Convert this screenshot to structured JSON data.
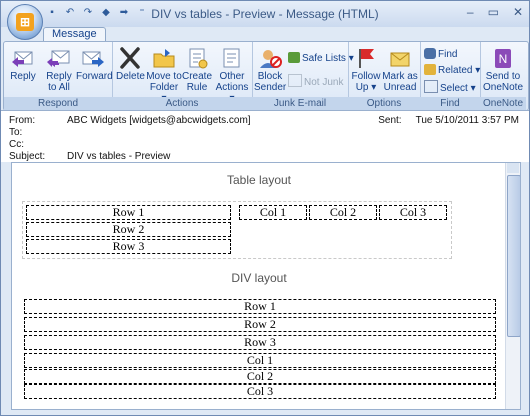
{
  "window": {
    "title": "DIV vs tables - Preview - Message (HTML)",
    "controls": {
      "minimize": "–",
      "maximize": "▭",
      "close": "✕"
    }
  },
  "ribbon": {
    "tab": "Message",
    "groups": {
      "respond": {
        "label": "Respond",
        "reply": "Reply",
        "reply_all_1": "Reply",
        "reply_all_2": "to All",
        "forward": "Forward"
      },
      "actions": {
        "label": "Actions",
        "delete": "Delete",
        "move_1": "Move to",
        "move_2": "Folder ▾",
        "rule_1": "Create",
        "rule_2": "Rule",
        "other_1": "Other",
        "other_2": "Actions ▾"
      },
      "junk": {
        "label": "Junk E-mail",
        "block_1": "Block",
        "block_2": "Sender",
        "safe": "Safe Lists ▾",
        "notjunk": "Not Junk"
      },
      "options": {
        "label": "Options",
        "follow_1": "Follow",
        "follow_2": "Up ▾",
        "unread_1": "Mark as",
        "unread_2": "Unread"
      },
      "find": {
        "label": "Find",
        "find": "Find",
        "related": "Related ▾",
        "select": "Select ▾"
      },
      "onenote": {
        "label": "OneNote",
        "send_1": "Send to",
        "send_2": "OneNote"
      }
    }
  },
  "headers": {
    "from_label": "From:",
    "from": "ABC Widgets [widgets@abcwidgets.com]",
    "to_label": "To:",
    "cc_label": "Cc:",
    "subject_label": "Subject:",
    "subject": "DIV vs tables - Preview",
    "sent_label": "Sent:",
    "sent": "Tue 5/10/2011 3:57 PM"
  },
  "body": {
    "table_title": "Table layout",
    "table_rows": [
      "Row 1",
      "Row 2",
      "Row 3"
    ],
    "table_cols": [
      "Col 1",
      "Col 2",
      "Col 3"
    ],
    "div_title": "DIV layout",
    "div_rows": [
      "Row 1",
      "Row 2",
      "Row 3",
      "Col 1",
      "Col 2",
      "Col 3"
    ]
  }
}
